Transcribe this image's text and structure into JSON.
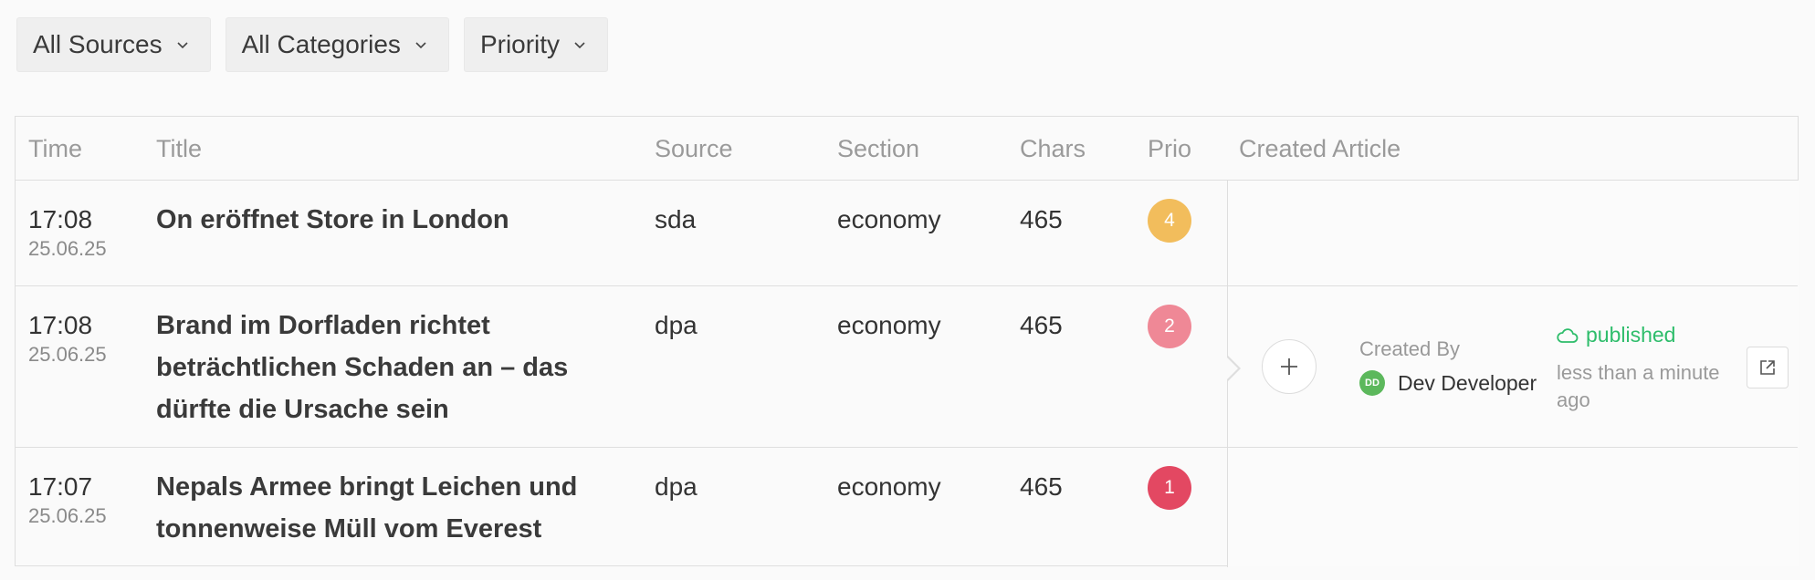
{
  "filters": [
    {
      "label": "All Sources"
    },
    {
      "label": "All Categories"
    },
    {
      "label": "Priority"
    }
  ],
  "columns": {
    "time": "Time",
    "title": "Title",
    "source": "Source",
    "section": "Section",
    "chars": "Chars",
    "prio": "Prio",
    "created_article": "Created Article"
  },
  "rows": [
    {
      "time": "17:08",
      "date": "25.06.25",
      "title": "On eröffnet Store in London",
      "source": "sda",
      "section": "economy",
      "chars": "465",
      "prio": "4",
      "prio_color": "#f2bd5c"
    },
    {
      "time": "17:08",
      "date": "25.06.25",
      "title": "Brand im Dorfladen richtet beträchtlichen Schaden an – das dürfte die Ursache sein",
      "source": "dpa",
      "section": "economy",
      "chars": "465",
      "prio": "2",
      "prio_color": "#ef8896"
    },
    {
      "time": "17:07",
      "date": "25.06.25",
      "title": "Nepals Armee bringt Leichen und tonnenweise Müll vom Everest",
      "source": "dpa",
      "section": "economy",
      "chars": "465",
      "prio": "1",
      "prio_color": "#e34862"
    }
  ],
  "article": {
    "created_by_label": "Created By",
    "avatar_initials": "DD",
    "creator_name": "Dev Developer",
    "status": "published",
    "status_time": "less than a minute ago",
    "status_color": "#2ebd6b"
  }
}
